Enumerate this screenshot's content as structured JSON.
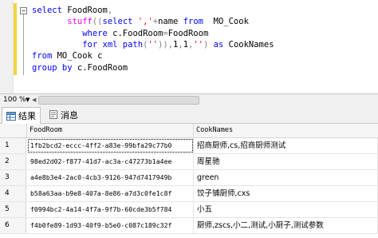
{
  "editor": {
    "lines": [
      [
        {
          "c": "kw",
          "t": "select "
        },
        {
          "c": "tx",
          "t": "FoodRoom"
        },
        {
          "c": "op",
          "t": ","
        }
      ],
      [
        {
          "c": "tx",
          "t": "       "
        },
        {
          "c": "fn",
          "t": "stuff"
        },
        {
          "c": "op",
          "t": "(("
        },
        {
          "c": "kw",
          "t": "select "
        },
        {
          "c": "str",
          "t": "','"
        },
        {
          "c": "op",
          "t": "+"
        },
        {
          "c": "tx",
          "t": "name "
        },
        {
          "c": "kw",
          "t": "from  "
        },
        {
          "c": "tx",
          "t": "MO_Cook"
        }
      ],
      [
        {
          "c": "tx",
          "t": "          "
        },
        {
          "c": "kw",
          "t": "where "
        },
        {
          "c": "tx",
          "t": "c.FoodRoom"
        },
        {
          "c": "op",
          "t": "="
        },
        {
          "c": "tx",
          "t": "FoodRoom"
        }
      ],
      [
        {
          "c": "tx",
          "t": "          "
        },
        {
          "c": "kw",
          "t": "for xml path"
        },
        {
          "c": "op",
          "t": "("
        },
        {
          "c": "str",
          "t": "''"
        },
        {
          "c": "op",
          "t": ")),"
        },
        {
          "c": "tx",
          "t": "1"
        },
        {
          "c": "op",
          "t": ","
        },
        {
          "c": "tx",
          "t": "1"
        },
        {
          "c": "op",
          "t": ","
        },
        {
          "c": "str",
          "t": "''"
        },
        {
          "c": "op",
          "t": ") "
        },
        {
          "c": "kw",
          "t": "as "
        },
        {
          "c": "tx",
          "t": "CookNames"
        }
      ],
      [
        {
          "c": "kw",
          "t": "from "
        },
        {
          "c": "tx",
          "t": "MO_Cook c"
        }
      ],
      [
        {
          "c": "kw",
          "t": "group by "
        },
        {
          "c": "tx",
          "t": "c.FoodRoom"
        }
      ]
    ]
  },
  "zoom": {
    "value": "100 %"
  },
  "tabs": [
    {
      "label": "结果",
      "icon": "grid-results-icon"
    },
    {
      "label": "消息",
      "icon": "messages-icon"
    }
  ],
  "grid": {
    "columns": [
      "FoodRoom",
      "CookNames"
    ],
    "rows": [
      {
        "n": "1",
        "id": "1fb2bcd2-eccc-4ff2-a83e-99bfa29c77b0",
        "names": "招商厨师,cs,招商厨师测试"
      },
      {
        "n": "2",
        "id": "98ed2d02-f877-41d7-ac3a-c47273b1a4ee",
        "names": "周星驰"
      },
      {
        "n": "3",
        "id": "a4e8b3e4-2ac0-4cb3-9126-947d7417949b",
        "names": "green"
      },
      {
        "n": "4",
        "id": "b58a63aa-b9e8-407a-8e86-a7d3c0fe1c8f",
        "names": "饺子铺厨师,cxs"
      },
      {
        "n": "5",
        "id": "f0994bc2-4a14-4f7a-9f7b-60cde3b5f784",
        "names": "小五"
      },
      {
        "n": "6",
        "id": "f4b0fe89-1d93-40f9-b5e0-c087c189c32f",
        "names": "厨师,zscs,小二,测试,小厨子,测试参数"
      }
    ]
  }
}
